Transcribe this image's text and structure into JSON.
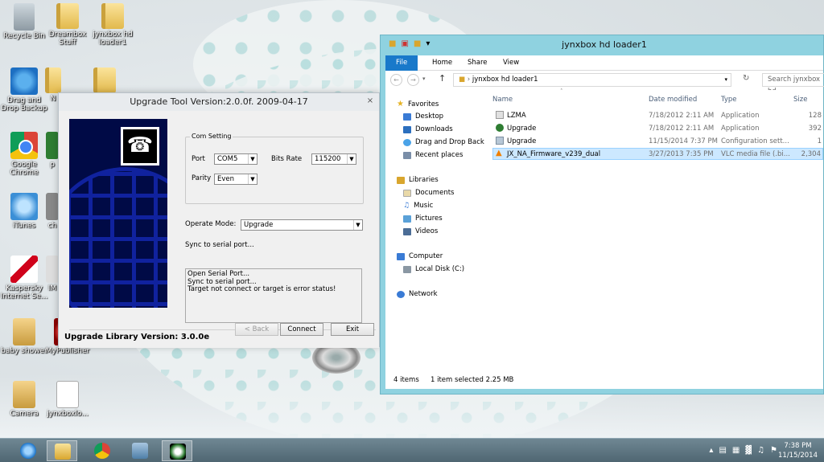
{
  "desktop": {
    "icons": [
      {
        "label": "Recycle Bin"
      },
      {
        "label": "Dreambox Stuff"
      },
      {
        "label": "jynxbox hd loader1"
      },
      {
        "label": "Drag and Drop Backup"
      },
      {
        "label": "N"
      },
      {
        "label": "Google Chrome"
      },
      {
        "label": "p"
      },
      {
        "label": "iTunes"
      },
      {
        "label": "ch"
      },
      {
        "label": "Kaspersky Internet Se..."
      },
      {
        "label": "IM"
      },
      {
        "label": "baby shower"
      },
      {
        "label": "MyPublisher"
      },
      {
        "label": "Camera"
      },
      {
        "label": "jynxboxlo..."
      }
    ]
  },
  "upgrade_tool": {
    "title": "Upgrade Tool Version:2.0.0f. 2009-04-17",
    "close": "×",
    "com_setting": {
      "legend": "Com Setting",
      "port_label": "Port",
      "port_value": "COM5",
      "bits_rate_label": "Bits Rate",
      "bits_rate_value": "115200",
      "parity_label": "Parity",
      "parity_value": "Even"
    },
    "operate_mode_label": "Operate Mode:",
    "operate_mode_value": "Upgrade",
    "status_text": "Sync to serial port...",
    "log_lines": [
      "Open Serial Port...",
      "Sync to serial port...",
      "Target not connect or target is error status!"
    ],
    "buttons": {
      "back": "< Back",
      "connect": "Connect",
      "exit": "Exit"
    },
    "library_version": "Upgrade Library Version: 3.0.0e"
  },
  "explorer": {
    "title": "jynxbox hd loader1",
    "ribbon_tabs": [
      "File",
      "Home",
      "Share",
      "View"
    ],
    "address": "jynxbox hd loader1",
    "search_placeholder": "Search jynxbox hd...",
    "nav": {
      "favorites": "Favorites",
      "desktop": "Desktop",
      "downloads": "Downloads",
      "dragdrop": "Drag and Drop Back",
      "recent": "Recent places",
      "libraries": "Libraries",
      "documents": "Documents",
      "music": "Music",
      "pictures": "Pictures",
      "videos": "Videos",
      "computer": "Computer",
      "localdisk": "Local Disk (C:)",
      "network": "Network"
    },
    "columns": {
      "name": "Name",
      "date": "Date modified",
      "type": "Type",
      "size": "Size"
    },
    "files": [
      {
        "name": "LZMA",
        "date": "7/18/2012 2:11 AM",
        "type": "Application",
        "size": "128"
      },
      {
        "name": "Upgrade",
        "date": "7/18/2012 2:11 AM",
        "type": "Application",
        "size": "392"
      },
      {
        "name": "Upgrade",
        "date": "11/15/2014 7:37 PM",
        "type": "Configuration sett...",
        "size": "1"
      },
      {
        "name": "JX_NA_Firmware_v239_dual",
        "date": "3/27/2013 7:35 PM",
        "type": "VLC media file (.bi...",
        "size": "2,304"
      }
    ],
    "status": {
      "items": "4 items",
      "selected": "1 item selected  2.25 MB"
    }
  },
  "taskbar": {
    "time": "7:38 PM",
    "date": "11/15/2014"
  }
}
